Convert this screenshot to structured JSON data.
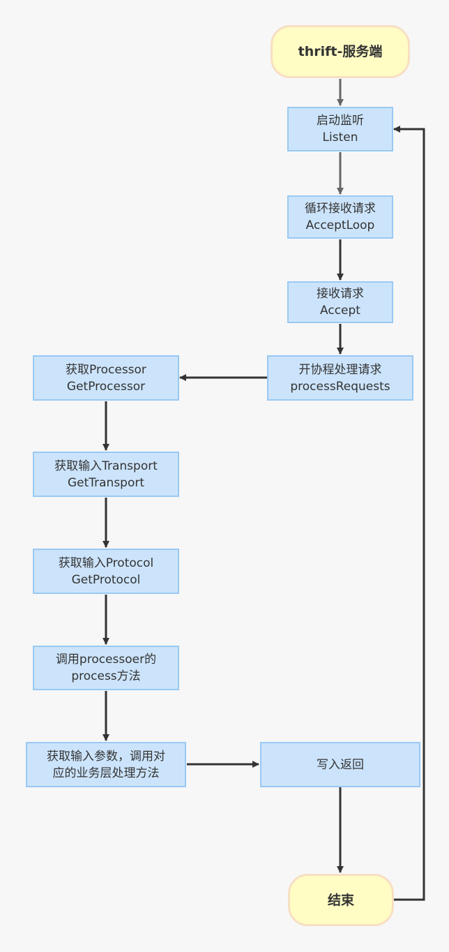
{
  "nodes": {
    "start": {
      "label": "thrift-服务端"
    },
    "listen": {
      "line1": "启动监听",
      "line2": "Listen"
    },
    "accept_loop": {
      "line1": "循环接收请求",
      "line2": "AcceptLoop"
    },
    "accept": {
      "line1": "接收请求",
      "line2": "Accept"
    },
    "process_requests": {
      "line1": "开协程处理请求",
      "line2": "processRequests"
    },
    "get_processor": {
      "line1": "获取Processor",
      "line2": "GetProcessor"
    },
    "get_transport": {
      "line1": "获取输入Transport",
      "line2": "GetTransport"
    },
    "get_protocol": {
      "line1": "获取输入Protocol",
      "line2": "GetProtocol"
    },
    "call_process": {
      "line1": "调用processoer的",
      "line2": "process方法"
    },
    "handle_business": {
      "line1": "获取输入参数，调用对",
      "line2": "应的业务层处理方法"
    },
    "write_return": {
      "label": "写入返回"
    },
    "end": {
      "label": "结束"
    }
  },
  "colors": {
    "box_fill": "#cce4fb",
    "box_border": "#99c9f3",
    "pill_fill": "#fffcc4",
    "pill_border": "#f7dfc4",
    "arrow_dark": "#333333",
    "arrow_gray": "#666666"
  }
}
